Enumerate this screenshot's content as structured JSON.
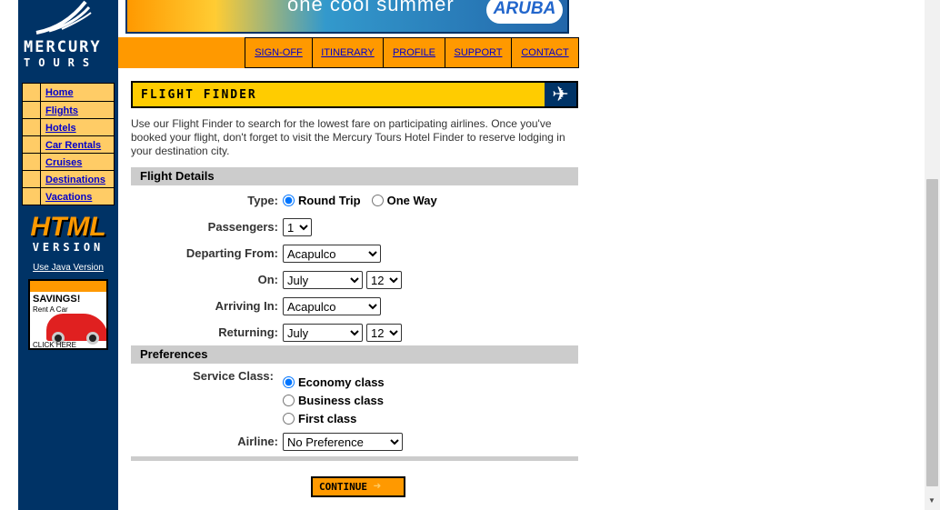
{
  "logo": {
    "line1": "MERCURY",
    "line2": "TOURS"
  },
  "banner": {
    "text": "one cool summer",
    "badge": "ARUBA"
  },
  "top_nav": [
    {
      "label": "SIGN-OFF"
    },
    {
      "label": "ITINERARY"
    },
    {
      "label": "PROFILE"
    },
    {
      "label": "SUPPORT"
    },
    {
      "label": "CONTACT"
    }
  ],
  "side_nav": [
    {
      "label": "Home"
    },
    {
      "label": "Flights"
    },
    {
      "label": "Hotels"
    },
    {
      "label": "Car Rentals"
    },
    {
      "label": "Cruises"
    },
    {
      "label": "Destinations"
    },
    {
      "label": "Vacations"
    }
  ],
  "html_version": {
    "big": "HTML",
    "sub": "VERSION",
    "java_link": "Use Java Version"
  },
  "ad": {
    "headline": "SAVINGS!",
    "sub": "Rent A Car",
    "cta": "CLICK HERE"
  },
  "finder": {
    "title": "FLIGHT FINDER",
    "intro": "Use our Flight Finder to search for the lowest fare on participating airlines. Once you've booked your flight, don't forget to visit the Mercury Tours Hotel Finder to reserve lodging in your destination city."
  },
  "flight_details": {
    "section_title": "Flight Details",
    "type_label": "Type:",
    "type_options": [
      "Round Trip",
      "One Way"
    ],
    "type_selected": "Round Trip",
    "passengers_label": "Passengers:",
    "passengers_value": "1",
    "departing_label": "Departing From:",
    "departing_value": "Acapulco",
    "on_label": "On:",
    "on_month": "July",
    "on_day": "12",
    "arriving_label": "Arriving In:",
    "arriving_value": "Acapulco",
    "returning_label": "Returning:",
    "returning_month": "July",
    "returning_day": "12"
  },
  "preferences": {
    "section_title": "Preferences",
    "service_label": "Service Class:",
    "service_options": [
      "Economy class",
      "Business class",
      "First class"
    ],
    "service_selected": "Economy class",
    "airline_label": "Airline:",
    "airline_value": "No Preference"
  },
  "continue_label": "CONTINUE",
  "colors": {
    "sidebar": "#003366",
    "accent": "#ff9900",
    "header": "#ffcc00",
    "section": "#cccccc",
    "link": "#0000cc"
  }
}
